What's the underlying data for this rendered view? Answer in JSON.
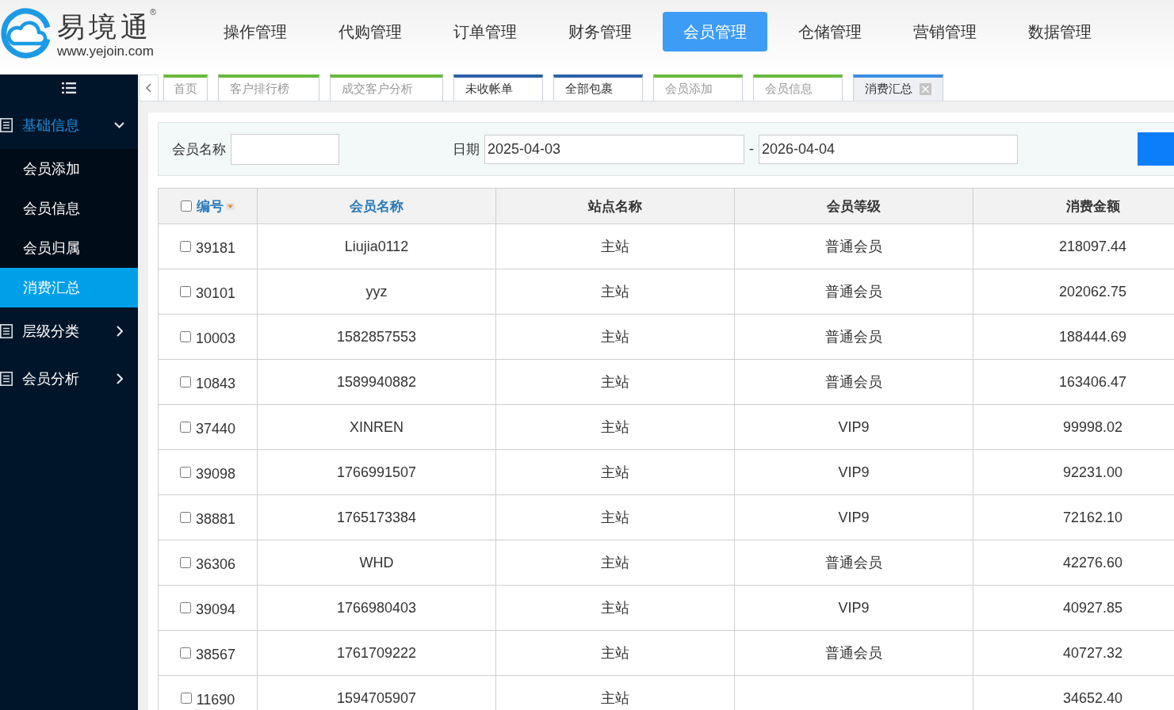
{
  "header": {
    "logo": {
      "name": "易境通",
      "mark": "®",
      "url": "www.yejoin.com"
    },
    "nav": [
      {
        "label": "操作管理",
        "selected": false
      },
      {
        "label": "代购管理",
        "selected": false
      },
      {
        "label": "订单管理",
        "selected": false
      },
      {
        "label": "财务管理",
        "selected": false
      },
      {
        "label": "会员管理",
        "selected": true
      },
      {
        "label": "仓储管理",
        "selected": false
      },
      {
        "label": "营销管理",
        "selected": false
      },
      {
        "label": "数据管理",
        "selected": false
      }
    ]
  },
  "sidebar": {
    "groups": [
      {
        "label": "基础信息",
        "expanded": true,
        "children": [
          {
            "label": "会员添加",
            "selected": false
          },
          {
            "label": "会员信息",
            "selected": false
          },
          {
            "label": "会员归属",
            "selected": false
          },
          {
            "label": "消费汇总",
            "selected": true
          }
        ]
      },
      {
        "label": "层级分类",
        "expanded": false
      },
      {
        "label": "会员分析",
        "expanded": false
      }
    ]
  },
  "tabs": [
    {
      "label": "首页",
      "color": "#6ab93e",
      "closable": false,
      "selected": false
    },
    {
      "label": "客户排行榜",
      "color": "#6ab93e",
      "closable": true,
      "selected": false
    },
    {
      "label": "成交客户分析",
      "color": "#6ab93e",
      "closable": true,
      "selected": false
    },
    {
      "label": "未收帐单",
      "color": "#2b62a8",
      "closable": true,
      "selected": false
    },
    {
      "label": "全部包裹",
      "color": "#2b62a8",
      "closable": true,
      "selected": false
    },
    {
      "label": "会员添加",
      "color": "#6ab93e",
      "closable": true,
      "selected": false
    },
    {
      "label": "会员信息",
      "color": "#6ab93e",
      "closable": true,
      "selected": false
    },
    {
      "label": "消费汇总",
      "color": "#3b8fe3",
      "closable": true,
      "selected": true
    }
  ],
  "search": {
    "member_name": {
      "label": "会员名称"
    },
    "date": {
      "label": "日期",
      "from": "2025-04-03",
      "separator": "-",
      "to": "2026-04-04"
    }
  },
  "table": {
    "all_checked": false,
    "columns": [
      {
        "label": "编号",
        "link": true,
        "sorted": true
      },
      {
        "label": "会员名称",
        "link": true,
        "sorted": false
      },
      {
        "label": "站点名称",
        "link": false,
        "sorted": false
      },
      {
        "label": "会员等级",
        "link": false,
        "sorted": false
      },
      {
        "label": "消费金额",
        "link": false,
        "sorted": false
      }
    ],
    "rows": [
      {
        "id": "39181",
        "checked": false,
        "member_name": "Liujia0112",
        "site": "主站",
        "member_grade": "普通会员",
        "amount": "218097.44"
      },
      {
        "id": "30101",
        "checked": false,
        "member_name": "yyz",
        "site": "主站",
        "member_grade": "普通会员",
        "amount": "202062.75"
      },
      {
        "id": "10003",
        "checked": false,
        "member_name": "1582857553",
        "site": "主站",
        "member_grade": "普通会员",
        "amount": "188444.69"
      },
      {
        "id": "10843",
        "checked": false,
        "member_name": "1589940882",
        "site": "主站",
        "member_grade": "普通会员",
        "amount": "163406.47"
      },
      {
        "id": "37440",
        "checked": false,
        "member_name": "XINREN",
        "site": "主站",
        "member_grade": "VIP9",
        "amount": "99998.02"
      },
      {
        "id": "39098",
        "checked": false,
        "member_name": "1766991507",
        "site": "主站",
        "member_grade": "VIP9",
        "amount": "92231.00"
      },
      {
        "id": "38881",
        "checked": false,
        "member_name": "1765173384",
        "site": "主站",
        "member_grade": "VIP9",
        "amount": "72162.10"
      },
      {
        "id": "36306",
        "checked": false,
        "member_name": "WHD",
        "site": "主站",
        "member_grade": "普通会员",
        "amount": "42276.60"
      },
      {
        "id": "39094",
        "checked": false,
        "member_name": "1766980403",
        "site": "主站",
        "member_grade": "VIP9",
        "amount": "40927.85"
      },
      {
        "id": "38567",
        "checked": false,
        "member_name": "1761709222",
        "site": "主站",
        "member_grade": "普通会员",
        "amount": "40727.32"
      },
      {
        "id": "11690",
        "checked": false,
        "member_name": "1594705907",
        "site": "主站",
        "amount": "34652.40"
      }
    ]
  }
}
